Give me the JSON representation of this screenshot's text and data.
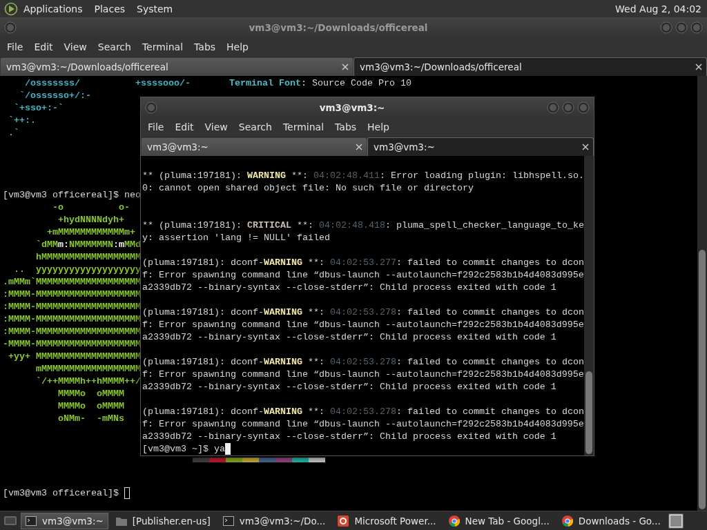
{
  "top_panel": {
    "menus": [
      "Applications",
      "Places",
      "System"
    ],
    "clock": "Wed Aug 2, 04:02"
  },
  "back_window": {
    "title": "vm3@vm3:~/Downloads/officereal",
    "focused": false,
    "menu": [
      "File",
      "Edit",
      "View",
      "Search",
      "Terminal",
      "Tabs",
      "Help"
    ],
    "tabs": [
      {
        "label": "vm3@vm3:~/Downloads/officereal",
        "selected": false
      },
      {
        "label": "vm3@vm3:~/Downloads/officereal",
        "selected": true
      }
    ],
    "lines": [
      {
        "kind": "text",
        "segments": [
          {
            "kind": "art-cyan",
            "text": "    /osssssss/          +ssssooo/-       "
          },
          {
            "kind": "label",
            "text": "Terminal Font"
          },
          {
            "kind": "plain",
            "text": ": Source Code Pro 10"
          }
        ]
      },
      {
        "kind": "text",
        "segments": [
          {
            "kind": "art-cyan",
            "text": "   `/ossssso+/:-"
          }
        ]
      },
      {
        "kind": "text",
        "segments": [
          {
            "kind": "art-cyan",
            "text": "  `+sso+:-`"
          }
        ]
      },
      {
        "kind": "text",
        "segments": [
          {
            "kind": "art-cyan",
            "text": " `++:."
          }
        ]
      },
      {
        "kind": "text",
        "segments": [
          {
            "kind": "art-cyan",
            "text": " .`"
          }
        ]
      },
      {
        "kind": "blank"
      },
      {
        "kind": "blank"
      },
      {
        "kind": "blank"
      },
      {
        "kind": "blank"
      },
      {
        "kind": "text",
        "segments": [
          {
            "kind": "plain",
            "text": "[vm3@vm3 officereal]$ neo"
          }
        ]
      },
      {
        "kind": "text",
        "segments": [
          {
            "kind": "art-green",
            "text": "         -o          o-"
          }
        ]
      },
      {
        "kind": "text",
        "segments": [
          {
            "kind": "art-green",
            "text": "          +hydNNNNdyh+"
          }
        ]
      },
      {
        "kind": "text",
        "segments": [
          {
            "kind": "art-green",
            "text": "        +mMMMMMMMMMMMMm+"
          }
        ]
      },
      {
        "kind": "text",
        "segments": [
          {
            "kind": "art-green",
            "text": "      `dMM"
          },
          {
            "kind": "bright",
            "text": "m:"
          },
          {
            "kind": "art-green",
            "text": "NMMMMMMN"
          },
          {
            "kind": "bright",
            "text": ":m"
          },
          {
            "kind": "art-green",
            "text": "MMd"
          }
        ]
      },
      {
        "kind": "text",
        "segments": [
          {
            "kind": "art-green",
            "text": "      hMMMMMMMMMMMMMMMMMM"
          }
        ]
      },
      {
        "kind": "text",
        "segments": [
          {
            "kind": "art-green",
            "text": "  ..  yyyyyyyyyyyyyyyyyyy"
          }
        ]
      },
      {
        "kind": "text",
        "segments": [
          {
            "kind": "art-green",
            "text": ".mMMm`MMMMMMMMMMMMMMMMMMM"
          }
        ]
      },
      {
        "kind": "text",
        "segments": [
          {
            "kind": "art-green",
            "text": ":MMMM-MMMMMMMMMMMMMMMMMMM"
          }
        ]
      },
      {
        "kind": "text",
        "segments": [
          {
            "kind": "art-green",
            "text": ":MMMM-MMMMMMMMMMMMMMMMMMM"
          }
        ]
      },
      {
        "kind": "text",
        "segments": [
          {
            "kind": "art-green",
            "text": ":MMMM-MMMMMMMMMMMMMMMMMMM"
          }
        ]
      },
      {
        "kind": "text",
        "segments": [
          {
            "kind": "art-green",
            "text": ":MMMM-MMMMMMMMMMMMMMMMMMM"
          }
        ]
      },
      {
        "kind": "text",
        "segments": [
          {
            "kind": "art-green",
            "text": "-MMMM-MMMMMMMMMMMMMMMMMMM"
          }
        ]
      },
      {
        "kind": "text",
        "segments": [
          {
            "kind": "art-green",
            "text": " +yy+ MMMMMMMMMMMMMMMMMMM"
          }
        ]
      },
      {
        "kind": "text",
        "segments": [
          {
            "kind": "art-green",
            "text": "      mMMMMMMMMMMMMMMMMMM"
          }
        ]
      },
      {
        "kind": "text",
        "segments": [
          {
            "kind": "art-green",
            "text": "      `/++MMMMh++hMMMM++/"
          }
        ]
      },
      {
        "kind": "text",
        "segments": [
          {
            "kind": "art-green",
            "text": "          MMMMo  oMMMM"
          }
        ]
      },
      {
        "kind": "text",
        "segments": [
          {
            "kind": "art-green",
            "text": "          MMMMo  oMMMM"
          }
        ]
      },
      {
        "kind": "text",
        "segments": [
          {
            "kind": "art-green",
            "text": "          oNMm-  -mMNs"
          }
        ]
      },
      {
        "kind": "blank"
      },
      {
        "kind": "blank"
      },
      {
        "kind": "palette",
        "swatches": [
          {
            "color": "#3c3c3c"
          },
          {
            "color": "#b0182a"
          },
          {
            "color": "#7a9a20"
          },
          {
            "color": "#b8a030"
          },
          {
            "color": "#3f5f8a"
          },
          {
            "color": "#8a3f7a"
          },
          {
            "color": "#1fa898"
          },
          {
            "color": "#b8b8b8"
          }
        ]
      },
      {
        "kind": "blank"
      },
      {
        "kind": "blank"
      },
      {
        "kind": "text",
        "cursor": true,
        "segments": [
          {
            "kind": "plain",
            "text": "[vm3@vm3 officereal]$ "
          }
        ]
      }
    ]
  },
  "front_window": {
    "title": "vm3@vm3:~",
    "focused": true,
    "menu": [
      "File",
      "Edit",
      "View",
      "Search",
      "Terminal",
      "Tabs",
      "Help"
    ],
    "tabs": [
      {
        "label": "vm3@vm3:~",
        "selected": false
      },
      {
        "label": "vm3@vm3:~",
        "selected": true
      }
    ],
    "lines": [
      {
        "kind": "blank"
      },
      {
        "kind": "text",
        "segments": [
          {
            "kind": "plain",
            "text": "** (pluma:197181): "
          },
          {
            "kind": "warning",
            "text": "WARNING"
          },
          {
            "kind": "plain",
            "text": " **: "
          },
          {
            "kind": "time",
            "text": "04:02:48.411"
          },
          {
            "kind": "plain",
            "text": ": Error loading plugin: libhspell.so."
          }
        ]
      },
      {
        "kind": "text",
        "segments": [
          {
            "kind": "plain",
            "text": "0: cannot open shared object file: No such file or directory"
          }
        ]
      },
      {
        "kind": "blank"
      },
      {
        "kind": "blank"
      },
      {
        "kind": "text",
        "segments": [
          {
            "kind": "plain",
            "text": "** (pluma:197181): "
          },
          {
            "kind": "critical",
            "text": "CRITICAL"
          },
          {
            "kind": "plain",
            "text": " **: "
          },
          {
            "kind": "time",
            "text": "04:02:48.418"
          },
          {
            "kind": "plain",
            "text": ": pluma_spell_checker_language_to_ke"
          }
        ]
      },
      {
        "kind": "text",
        "segments": [
          {
            "kind": "plain",
            "text": "y: assertion 'lang != NULL' failed"
          }
        ]
      },
      {
        "kind": "blank"
      },
      {
        "kind": "text",
        "segments": [
          {
            "kind": "plain",
            "text": "(pluma:197181): dconf-"
          },
          {
            "kind": "warning",
            "text": "WARNING"
          },
          {
            "kind": "plain",
            "text": " **: "
          },
          {
            "kind": "time",
            "text": "04:02:53.277"
          },
          {
            "kind": "plain",
            "text": ": failed to commit changes to dcon"
          }
        ]
      },
      {
        "kind": "text",
        "segments": [
          {
            "kind": "plain",
            "text": "f: Error spawning command line “dbus-launch --autolaunch=f292c2583b1b4d4083d995e"
          }
        ]
      },
      {
        "kind": "text",
        "segments": [
          {
            "kind": "plain",
            "text": "a2339db72 --binary-syntax --close-stderr”: Child process exited with code 1"
          }
        ]
      },
      {
        "kind": "blank"
      },
      {
        "kind": "text",
        "segments": [
          {
            "kind": "plain",
            "text": "(pluma:197181): dconf-"
          },
          {
            "kind": "warning",
            "text": "WARNING"
          },
          {
            "kind": "plain",
            "text": " **: "
          },
          {
            "kind": "time",
            "text": "04:02:53.278"
          },
          {
            "kind": "plain",
            "text": ": failed to commit changes to dcon"
          }
        ]
      },
      {
        "kind": "text",
        "segments": [
          {
            "kind": "plain",
            "text": "f: Error spawning command line “dbus-launch --autolaunch=f292c2583b1b4d4083d995e"
          }
        ]
      },
      {
        "kind": "text",
        "segments": [
          {
            "kind": "plain",
            "text": "a2339db72 --binary-syntax --close-stderr”: Child process exited with code 1"
          }
        ]
      },
      {
        "kind": "blank"
      },
      {
        "kind": "text",
        "segments": [
          {
            "kind": "plain",
            "text": "(pluma:197181): dconf-"
          },
          {
            "kind": "warning",
            "text": "WARNING"
          },
          {
            "kind": "plain",
            "text": " **: "
          },
          {
            "kind": "time",
            "text": "04:02:53.278"
          },
          {
            "kind": "plain",
            "text": ": failed to commit changes to dcon"
          }
        ]
      },
      {
        "kind": "text",
        "segments": [
          {
            "kind": "plain",
            "text": "f: Error spawning command line “dbus-launch --autolaunch=f292c2583b1b4d4083d995e"
          }
        ]
      },
      {
        "kind": "text",
        "segments": [
          {
            "kind": "plain",
            "text": "a2339db72 --binary-syntax --close-stderr”: Child process exited with code 1"
          }
        ]
      },
      {
        "kind": "blank"
      },
      {
        "kind": "text",
        "segments": [
          {
            "kind": "plain",
            "text": "(pluma:197181): dconf-"
          },
          {
            "kind": "warning",
            "text": "WARNING"
          },
          {
            "kind": "plain",
            "text": " **: "
          },
          {
            "kind": "time",
            "text": "04:02:53.278"
          },
          {
            "kind": "plain",
            "text": ": failed to commit changes to dcon"
          }
        ]
      },
      {
        "kind": "text",
        "segments": [
          {
            "kind": "plain",
            "text": "f: Error spawning command line “dbus-launch --autolaunch=f292c2583b1b4d4083d995e"
          }
        ]
      },
      {
        "kind": "text",
        "segments": [
          {
            "kind": "plain",
            "text": "a2339db72 --binary-syntax --close-stderr”: Child process exited with code 1"
          }
        ]
      },
      {
        "kind": "text",
        "cursor": true,
        "segments": [
          {
            "kind": "plain",
            "text": "[vm3@vm3 ~]$ ya"
          }
        ]
      }
    ]
  },
  "taskbar": {
    "items": [
      {
        "kind": "terminal",
        "label": "vm3@vm3:~",
        "selected": true
      },
      {
        "kind": "folder",
        "label": "[Publisher.en-us]",
        "selected": false
      },
      {
        "kind": "terminal",
        "label": "vm3@vm3:~/Do...",
        "selected": false
      },
      {
        "kind": "slides",
        "label": "Microsoft Power...",
        "selected": false
      },
      {
        "kind": "browser",
        "label": "New Tab - Googl...",
        "selected": false
      },
      {
        "kind": "browser",
        "label": "Downloads - Go...",
        "selected": false
      }
    ]
  }
}
